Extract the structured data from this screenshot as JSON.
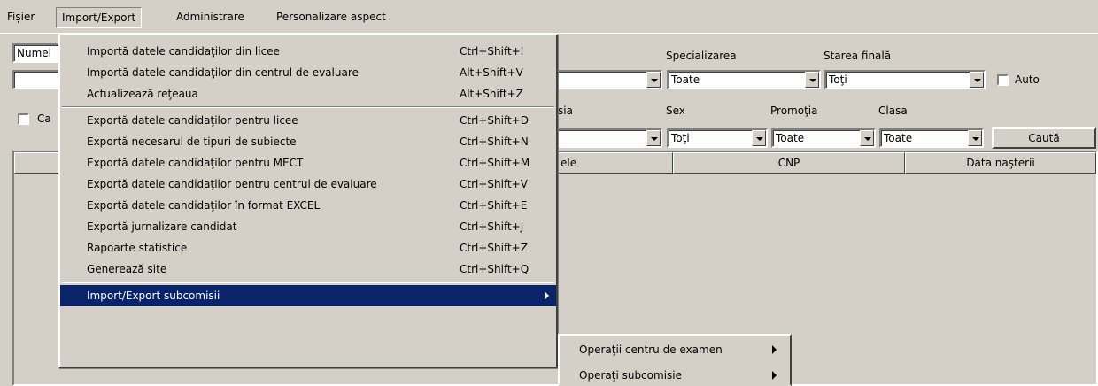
{
  "menubar": [
    {
      "name": "menu-fisier",
      "label": "Fișier"
    },
    {
      "name": "menu-import-export",
      "label": "Import/Export"
    },
    {
      "name": "menu-administrare",
      "label": "Administrare"
    },
    {
      "name": "menu-personalizare-aspect",
      "label": "Personalizare aspect"
    }
  ],
  "search_panel": {
    "name_combo_value": "Numel",
    "search_field_value": "",
    "checkbox_ca_label": "Ca",
    "specializarea_label": "Specializarea",
    "specializarea_value": "Toate",
    "starea_finala_label": "Starea finală",
    "starea_finala_value": "Toţi",
    "auto_label": "Auto",
    "sesiunea_label": "sia",
    "sex_label": "Sex",
    "sex_value": "Toţi",
    "promotia_label": "Promoţia",
    "promotia_value": "Toate",
    "clasa_label": "Clasa",
    "clasa_value": "Toate",
    "search_button": "Caută"
  },
  "grid": {
    "columns": [
      "ele",
      "CNP",
      "Data naşterii"
    ],
    "rows": []
  },
  "dropdown": {
    "items": [
      {
        "label": "Importă datele candidaţilor din licee",
        "shortcut": "Ctrl+Shift+I"
      },
      {
        "label": "Importă datele candidaţilor din centrul de evaluare",
        "shortcut": "Alt+Shift+V"
      },
      {
        "label": "Actualizează reţeaua",
        "shortcut": "Alt+Shift+Z"
      },
      {
        "label": "Exportă datele candidaţilor pentru licee",
        "shortcut": "Ctrl+Shift+D"
      },
      {
        "label": "Exportă necesarul de tipuri de subiecte",
        "shortcut": "Ctrl+Shift+N"
      },
      {
        "label": "Exportă datele candidaţilor pentru MECT",
        "shortcut": "Ctrl+Shift+M"
      },
      {
        "label": "Exportă datele candidaţilor pentru centrul de evaluare",
        "shortcut": "Ctrl+Shift+V"
      },
      {
        "label": "Exportă datele candidaţilor în format EXCEL",
        "shortcut": "Ctrl+Shift+E"
      },
      {
        "label": "Exportă jurnalizare candidat",
        "shortcut": "Ctrl+Shift+J"
      },
      {
        "label": "Rapoarte statistice",
        "shortcut": "Ctrl+Shift+Z"
      },
      {
        "label": "Generează site",
        "shortcut": "Ctrl+Shift+Q"
      },
      {
        "label": "Import/Export subcomisii",
        "shortcut": ""
      }
    ]
  },
  "submenu": {
    "items": [
      {
        "label": "Operaţii centru de examen"
      },
      {
        "label": "Operaţi subcomisie"
      }
    ]
  },
  "colors": {
    "face": "#d4d0c8",
    "highlight": "#0a246a",
    "highlight_text": "#ffffff"
  }
}
